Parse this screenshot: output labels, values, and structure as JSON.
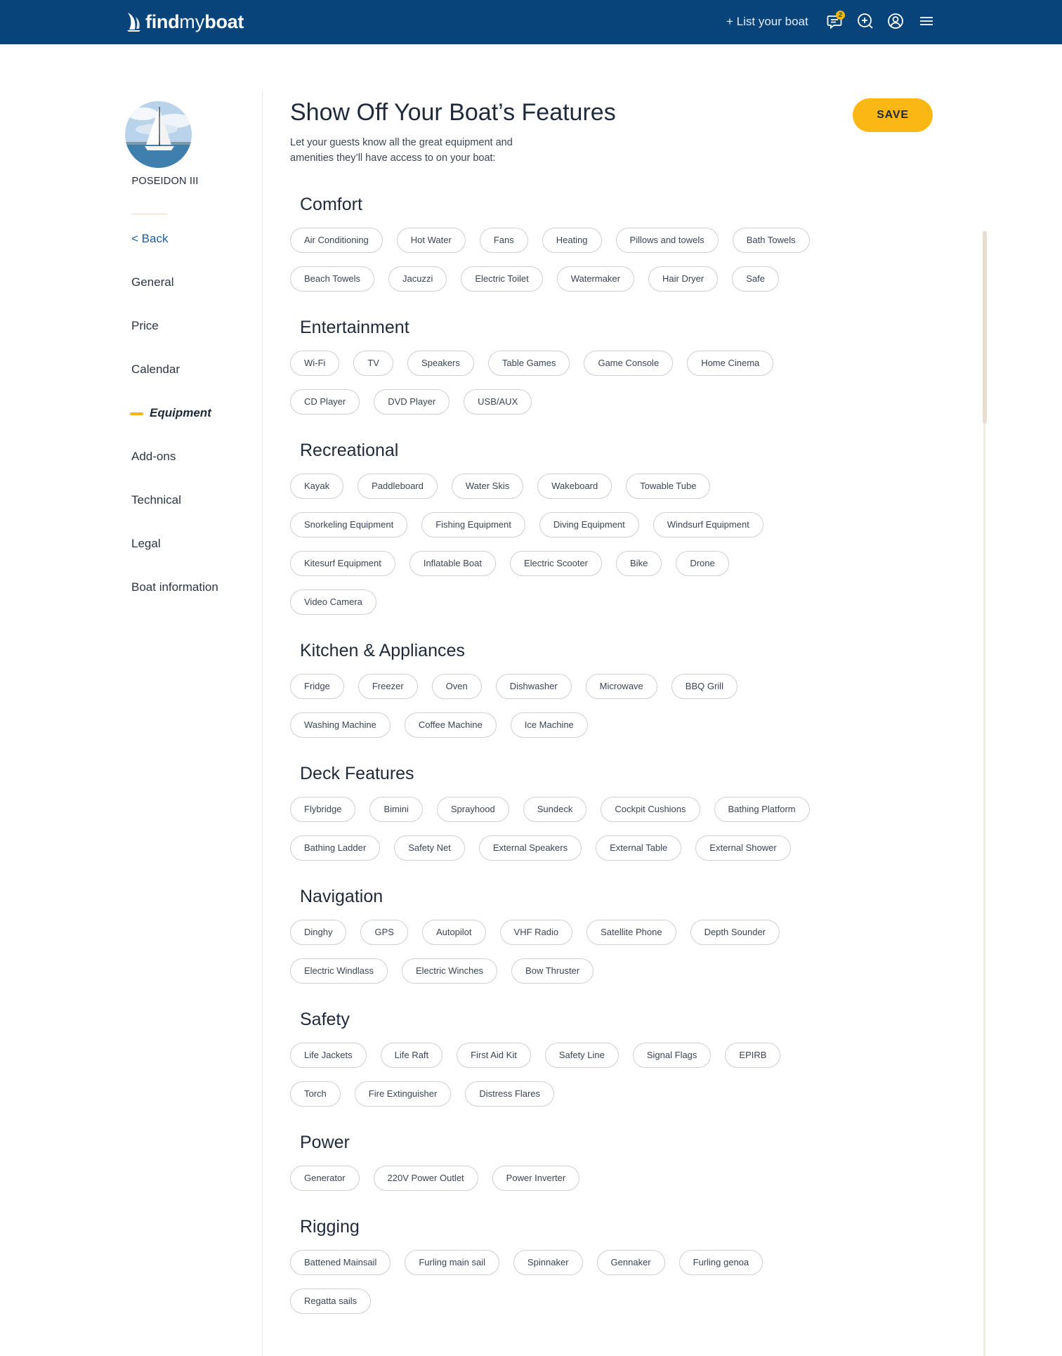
{
  "header": {
    "logo": {
      "find": "find",
      "my": "my",
      "boat": "boat"
    },
    "list_boat": "+ List your boat",
    "message_count": "2",
    "icons": [
      "message-icon",
      "add-circle-icon",
      "user-circle-icon",
      "hamburger-menu-icon"
    ],
    "bg_color": "#08447a",
    "accent_color": "#fbb815"
  },
  "sidebar": {
    "boat_name": "POSEIDON III",
    "back": "< Back",
    "items": [
      "General",
      "Price",
      "Calendar",
      "Equipment",
      "Add-ons",
      "Technical",
      "Legal",
      "Boat information"
    ],
    "active": "Equipment"
  },
  "main": {
    "title": "Show Off Your Boat’s Features",
    "subtitle": "Let your guests know all the great equipment and amenities they’ll have access to on your boat:",
    "save_label": "SAVE"
  },
  "sections": [
    {
      "title": "Comfort",
      "items": [
        "Air Conditioning",
        "Hot Water",
        "Fans",
        "Heating",
        "Pillows and towels",
        "Bath Towels",
        "Beach Towels",
        "Jacuzzi",
        "Electric Toilet",
        "Watermaker",
        "Hair Dryer",
        "Safe"
      ]
    },
    {
      "title": "Entertainment",
      "items": [
        "Wi-Fi",
        "TV",
        "Speakers",
        "Table Games",
        "Game Console",
        "Home Cinema",
        "CD Player",
        "DVD Player",
        "USB/AUX"
      ]
    },
    {
      "title": "Recreational",
      "items": [
        "Kayak",
        "Paddleboard",
        "Water Skis",
        "Wakeboard",
        "Towable Tube",
        "Snorkeling Equipment",
        "Fishing Equipment",
        "Diving Equipment",
        "Windsurf Equipment",
        "Kitesurf Equipment",
        "Inflatable Boat",
        "Electric Scooter",
        "Bike",
        "Drone",
        "Video Camera"
      ]
    },
    {
      "title": "Kitchen & Appliances",
      "items": [
        "Fridge",
        "Freezer",
        "Oven",
        "Dishwasher",
        "Microwave",
        "BBQ Grill",
        "Washing Machine",
        "Coffee Machine",
        "Ice Machine"
      ]
    },
    {
      "title": "Deck Features",
      "items": [
        "Flybridge",
        "Bimini",
        "Sprayhood",
        "Sundeck",
        "Cockpit Cushions",
        "Bathing Platform",
        "Bathing Ladder",
        "Safety Net",
        "External Speakers",
        "External Table",
        "External Shower"
      ]
    },
    {
      "title": "Navigation",
      "items": [
        "Dinghy",
        "GPS",
        "Autopilot",
        "VHF Radio",
        "Satellite Phone",
        "Depth Sounder",
        "Electric Windlass",
        "Electric Winches",
        "Bow Thruster"
      ]
    },
    {
      "title": "Safety",
      "items": [
        "Life Jackets",
        "Life Raft",
        "First Aid Kit",
        "Safety Line",
        "Signal Flags",
        "EPIRB",
        "Torch",
        "Fire Extinguisher",
        "Distress Flares"
      ]
    },
    {
      "title": "Power",
      "items": [
        "Generator",
        "220V Power Outlet",
        "Power Inverter"
      ]
    },
    {
      "title": "Rigging",
      "items": [
        "Battened Mainsail",
        "Furling main sail",
        "Spinnaker",
        "Gennaker",
        "Furling genoa",
        "Regatta sails"
      ]
    }
  ]
}
